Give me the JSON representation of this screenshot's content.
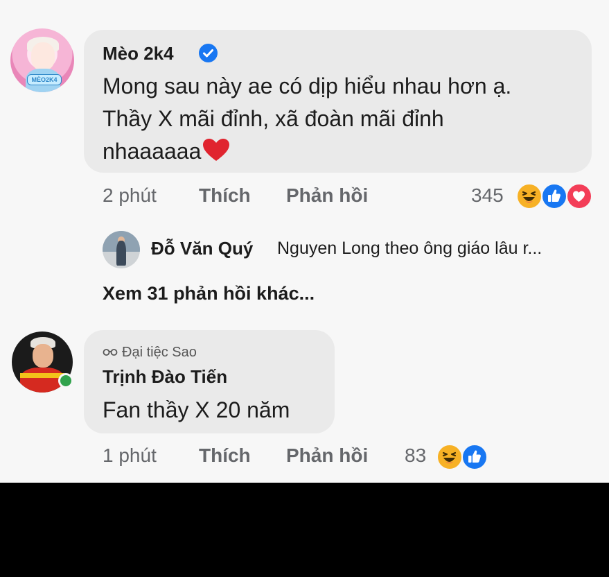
{
  "comments": [
    {
      "author": "Mèo 2k4",
      "avatar_badge_text": "MÈO2K4",
      "verified": true,
      "lines": [
        "Mong sau này ae có dịp hiểu nhau hơn ạ.",
        "Thầy X mãi đỉnh, xã đoàn mãi đỉnh",
        "nhaaaaaa"
      ],
      "time": "2 phút",
      "like_label": "Thích",
      "reply_label": "Phản hồi",
      "reaction_count": "345",
      "reactions": [
        "haha-icon",
        "like-icon",
        "love-icon"
      ]
    },
    {
      "badge": "Đại tiệc Sao",
      "author": "Trịnh Đào Tiến",
      "lines": [
        "Fan thầy X 20 năm"
      ],
      "time": "1 phút",
      "like_label": "Thích",
      "reply_label": "Phản hồi",
      "reaction_count": "83",
      "reactions": [
        "haha-icon",
        "like-icon"
      ],
      "online": true
    }
  ],
  "reply_preview": {
    "author": "Đỗ Văn Quý",
    "text": "Nguyen Long theo ông giáo lâu r..."
  },
  "more_replies": "Xem 31 phản hồi khác...",
  "colors": {
    "background": "#f7f7f7",
    "bubble": "#eaeaea",
    "meta_text": "#65676b",
    "verified_blue": "#1877f2",
    "haha_yellow": "#f7b125",
    "love_red": "#f33e58",
    "online_green": "#31a24c"
  }
}
